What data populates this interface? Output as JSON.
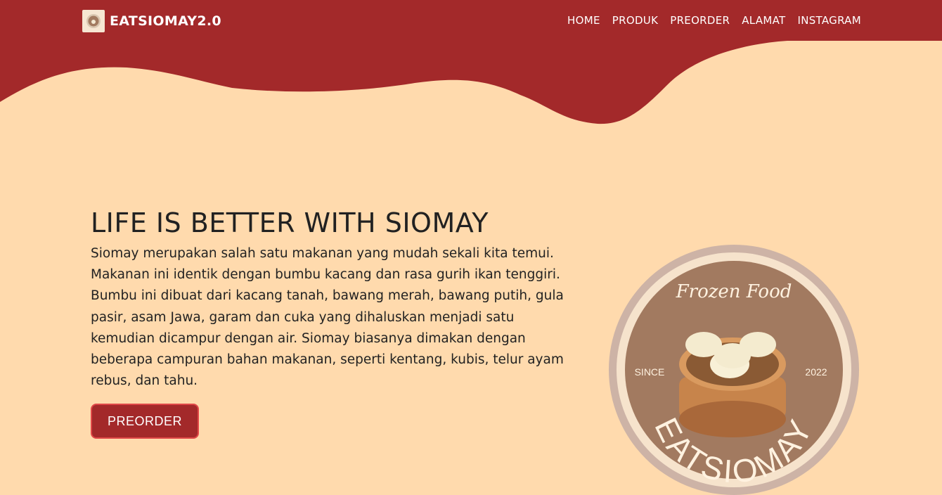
{
  "brand": {
    "name": "EATSIOMAY2.0",
    "logo_icon": "siomay-logo-icon"
  },
  "nav": {
    "items": [
      "HOME",
      "PRODUK",
      "PREORDER",
      "ALAMAT",
      "INSTAGRAM"
    ]
  },
  "hero": {
    "title": "LIFE IS BETTER WITH SIOMAY",
    "text": "Siomay merupakan salah satu makanan yang mudah sekali kita temui. Makanan ini identik dengan bumbu kacang dan rasa gurih ikan tenggiri. Bumbu ini dibuat dari kacang tanah, bawang merah, bawang putih, gula pasir, asam Jawa, garam dan cuka yang dihaluskan menjadi satu kemudian dicampur dengan air. Siomay biasanya dimakan dengan beberapa campuran bahan makanan, seperti kentang, kubis, telur ayam rebus, dan tahu.",
    "cta_label": "PREORDER"
  },
  "badge": {
    "script_text": "Frozen Food",
    "since_label": "SINCE",
    "year": "2022",
    "brand_arc": "EATSIOMAY"
  },
  "colors": {
    "primary": "#A3292A",
    "background": "#FFDAAD",
    "badge_fill": "#A27A60",
    "badge_ring": "#F6E3CC"
  }
}
